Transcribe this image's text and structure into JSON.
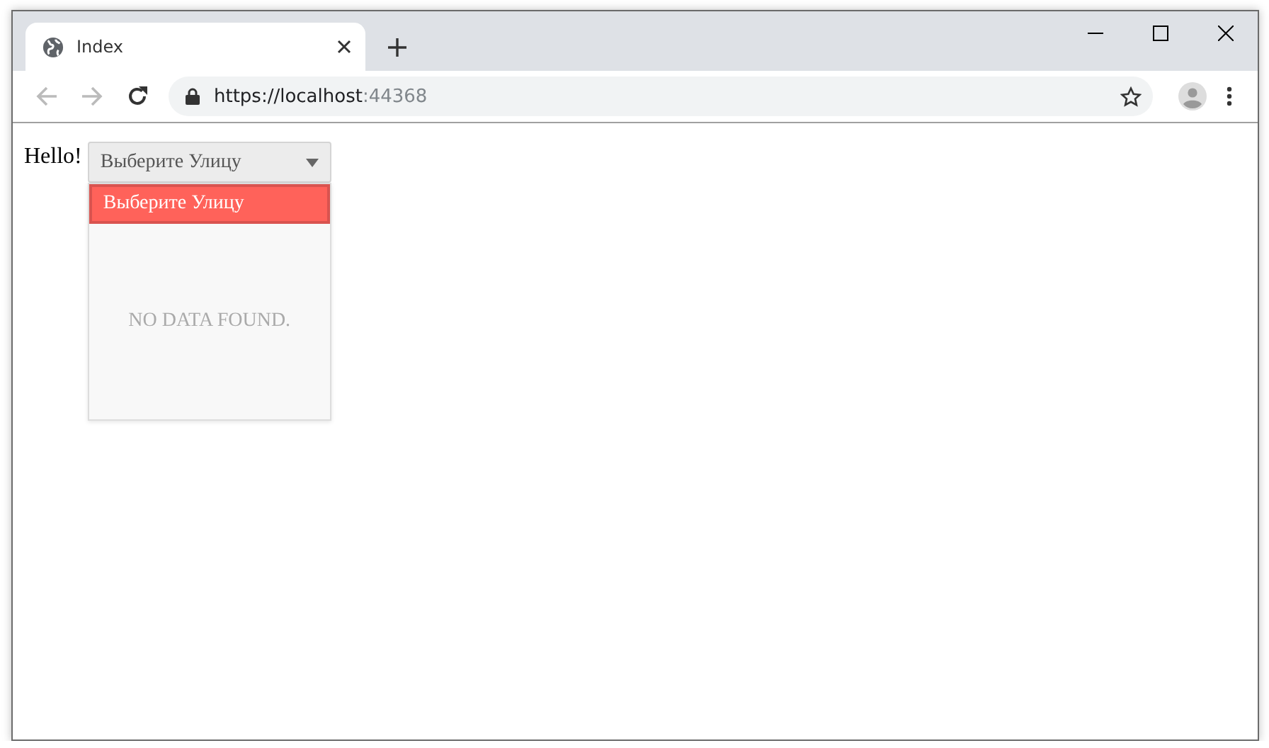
{
  "browser": {
    "tab": {
      "title": "Index",
      "selected": true
    },
    "address": {
      "scheme_host": "https://localhost",
      "port": ":44368"
    }
  },
  "page": {
    "greeting": "Hello!",
    "select": {
      "value": "Выберите Улицу",
      "expanded": true,
      "options": [
        {
          "label": "Выберите Улицу",
          "selected": true
        }
      ],
      "empty_message": "NO DATA FOUND."
    }
  }
}
